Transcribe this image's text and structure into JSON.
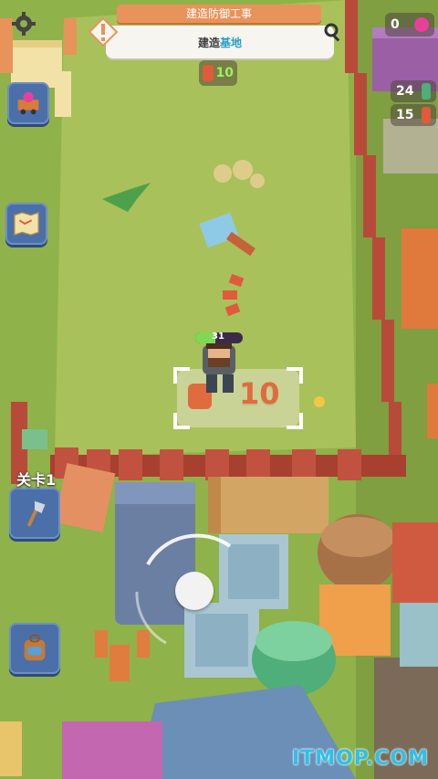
{
  "quest": {
    "title": "建造防御工事",
    "task_prefix": "建造",
    "task_target": "基地"
  },
  "resources": {
    "top_count": "0",
    "wood_small": "24",
    "meat_small": "15"
  },
  "build_cost_top": "10",
  "build_spot_cost": "10",
  "player_level": "31",
  "stage_label": "关卡1",
  "watermark": "ITMOP.COM",
  "colors": {
    "grass": "#8fb24a",
    "field": "#a9c15a",
    "fence": "#b84a3a",
    "accent": "#e8935a"
  },
  "icons": [
    "gear-icon",
    "alert-icon",
    "search-icon",
    "mine-cart-icon",
    "map-icon",
    "axe-icon",
    "backpack-icon",
    "gem-icon",
    "meat-icon",
    "hammer-icon"
  ]
}
